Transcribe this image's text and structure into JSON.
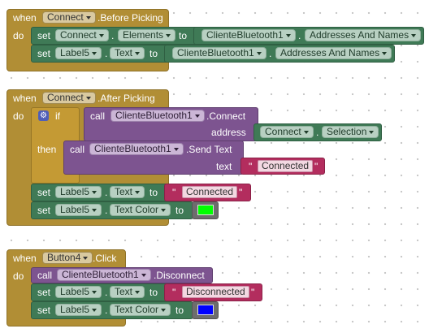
{
  "blocks": {
    "event1": {
      "when": "when",
      "component": "Connect",
      "event": ".Before Picking",
      "do": "do",
      "set1": {
        "set": "set",
        "component": "Connect",
        "prop": "Elements",
        "to": "to",
        "getter_component": "ClienteBluetooth1",
        "getter_prop": "Addresses And Names"
      },
      "set2": {
        "set": "set",
        "component": "Label5",
        "prop": "Text",
        "to": "to",
        "getter_component": "ClienteBluetooth1",
        "getter_prop": "Addresses And Names"
      }
    },
    "event2": {
      "when": "when",
      "component": "Connect",
      "event": ".After Picking",
      "do": "do",
      "if": "if",
      "then": "then",
      "cond": {
        "call": "call",
        "component": "ClienteBluetooth1",
        "method": ".Connect",
        "arg": "address",
        "arg_component": "Connect",
        "arg_prop": "Selection"
      },
      "send": {
        "call": "call",
        "component": "ClienteBluetooth1",
        "method": ".Send Text",
        "arg": "text",
        "value": "Connected"
      },
      "set1": {
        "set": "set",
        "component": "Label5",
        "prop": "Text",
        "to": "to",
        "value": "Connected"
      },
      "set2": {
        "set": "set",
        "component": "Label5",
        "prop": "Text Color",
        "to": "to",
        "color": "#00ff00"
      }
    },
    "event3": {
      "when": "when",
      "component": "Button4",
      "event": ".Click",
      "do": "do",
      "call": {
        "call": "call",
        "component": "ClienteBluetooth1",
        "method": ".Disconnect"
      },
      "set1": {
        "set": "set",
        "component": "Label5",
        "prop": "Text",
        "to": "to",
        "value": "Disconnected"
      },
      "set2": {
        "set": "set",
        "component": "Label5",
        "prop": "Text Color",
        "to": "to",
        "color": "#0000ff"
      }
    }
  },
  "quote": "\"",
  "dot": ".",
  "gear_icon": "gear-icon"
}
